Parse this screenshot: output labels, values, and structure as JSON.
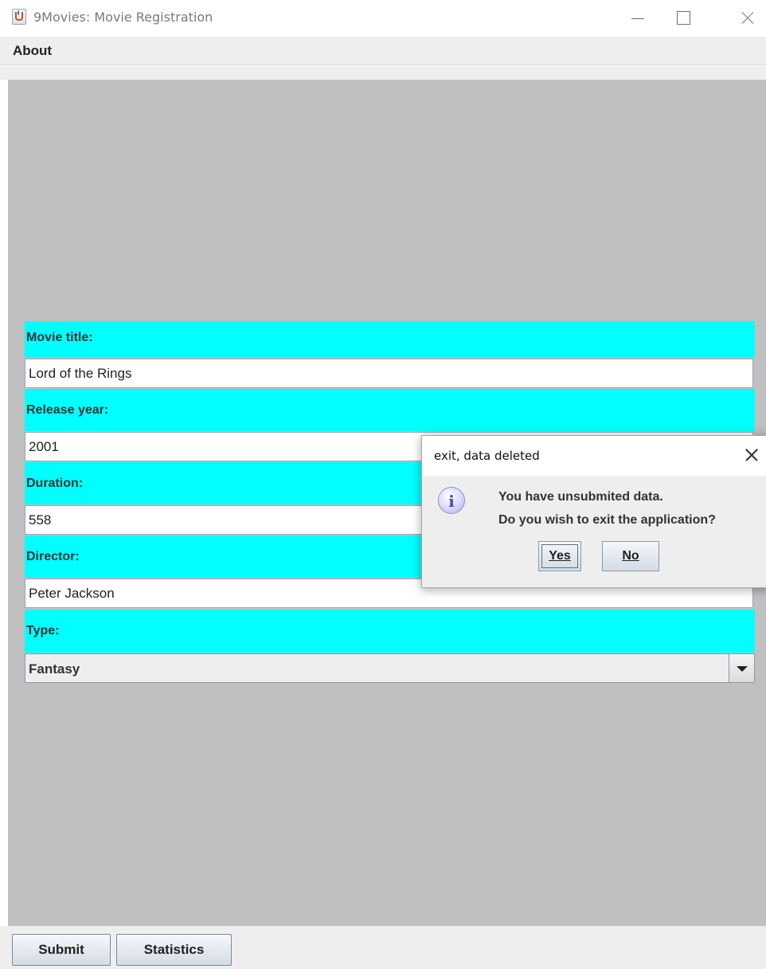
{
  "window": {
    "title": "9Movies: Movie Registration",
    "icon": "java-cup-icon"
  },
  "menu": {
    "about": "About"
  },
  "form": {
    "title_label": "Movie title:",
    "title_value": "Lord of the Rings",
    "year_label": "Release year:",
    "year_value": "2001",
    "duration_label": "Duration:",
    "duration_value": "558",
    "director_label": "Director:",
    "director_value": "Peter Jackson",
    "type_label": "Type:",
    "type_value": "Fantasy"
  },
  "buttons": {
    "submit": "Submit",
    "statistics": "Statistics"
  },
  "dialog": {
    "title": "exit, data deleted",
    "icon": "info-icon",
    "line1": "You have unsubmited data.",
    "line2": "Do you wish to exit the application?",
    "yes": "Yes",
    "no": "No"
  },
  "colors": {
    "label_background": "#00ffff",
    "panel_background": "#c0c0c0"
  }
}
